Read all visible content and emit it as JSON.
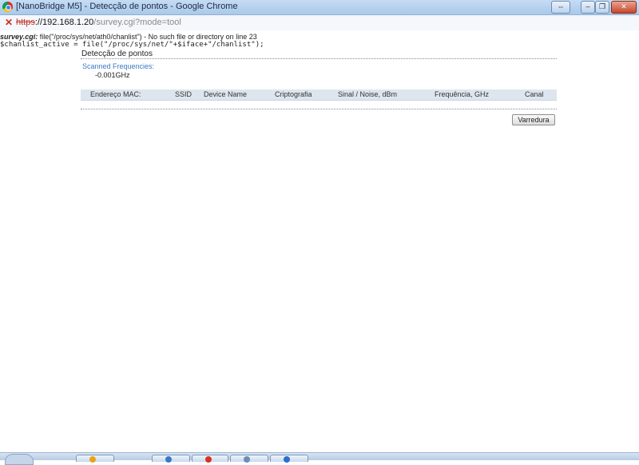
{
  "window": {
    "title": "[NanoBridge M5] - Detecção de pontos - Google Chrome",
    "buttons": [
      "⇔",
      "–",
      "❐",
      "✕"
    ]
  },
  "address": {
    "protocol": "https",
    "host": "://192.168.1.20",
    "path": "/survey.cgi?mode=tool"
  },
  "errors": {
    "line1_prefix": "survey.cgi:",
    "line1_rest": " file(\"/proc/sys/net/ath0/chanlist\") - No such file or directory on line 23",
    "line2": "$chanlist_active = file(\"/proc/sys/net/\"+$iface+\"/chanlist\");"
  },
  "page": {
    "title": "Detecção de pontos",
    "scanned_label": "Scanned Frequencies:",
    "scanned_value": "-0.001GHz",
    "columns": [
      "Endereço MAC:",
      "SSID",
      "Device Name",
      "Criptografia",
      "Sinal / Noise, dBm",
      "Frequência, GHz",
      "Canal"
    ],
    "scan_button": "Varredura"
  },
  "colors": {
    "accent": "#3b79c6",
    "header_bg": "#dde6ee"
  },
  "icons": {
    "browser": "chrome-icon",
    "security": "insecure-x-icon"
  }
}
